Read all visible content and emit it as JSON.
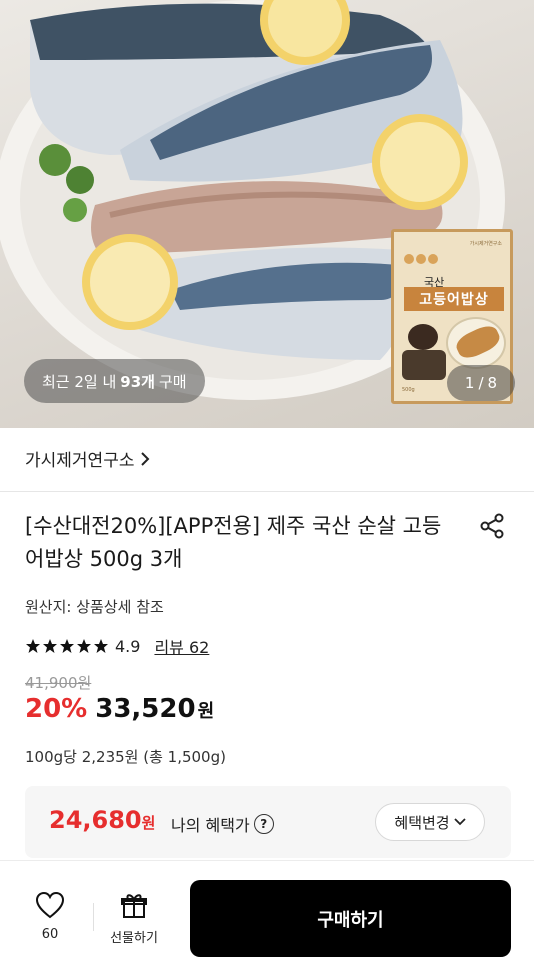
{
  "hero": {
    "recent_prefix": "최근 2일 내",
    "recent_count": "93개",
    "recent_suffix": "구매",
    "page_current": "1",
    "page_sep": "/",
    "page_total": "8",
    "package": {
      "small_text": "가시제거연구소",
      "top_label": "국산",
      "main_label": "고등어밥상",
      "weight": "500g"
    }
  },
  "store": {
    "name": "가시제거연구소",
    "chevron_icon": "chevron-right-icon"
  },
  "product": {
    "title": "[수산대전20%][APP전용] 제주 국산 순살 고등어밥상 500g 3개",
    "origin": "원산지: 상품상세 참조",
    "rating": "4.9",
    "stars": 5,
    "review_label": "리뷰 62",
    "original_price": "41,900원",
    "discount": "20%",
    "price": "33,520",
    "price_unit": "원",
    "unit_price": "100g당 2,235원 (총 1,500g)"
  },
  "benefit": {
    "price": "24,680",
    "price_unit": "원",
    "label": "나의 혜택가",
    "help_icon": "question-icon",
    "change_label": "혜택변경"
  },
  "bottom": {
    "like_count": "60",
    "gift_label": "선물하기",
    "buy_label": "구매하기"
  },
  "colors": {
    "accent_red": "#e62e2e",
    "buy_button": "#000000",
    "star": "#111111"
  }
}
